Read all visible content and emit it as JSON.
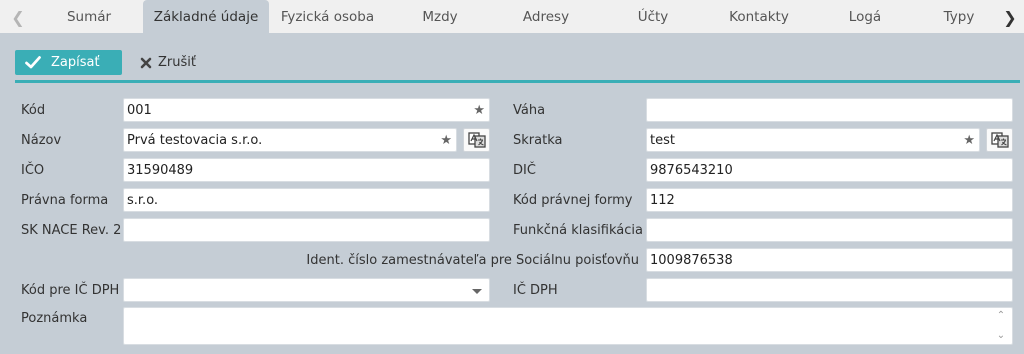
{
  "tabs": [
    {
      "label": "Sumár",
      "active": false
    },
    {
      "label": "Základné údaje",
      "active": true
    },
    {
      "label": "Fyzická osoba",
      "active": false
    },
    {
      "label": "Mzdy",
      "active": false
    },
    {
      "label": "Adresy",
      "active": false
    },
    {
      "label": "Účty",
      "active": false
    },
    {
      "label": "Kontakty",
      "active": false
    },
    {
      "label": "Logá",
      "active": false
    },
    {
      "label": "Typy",
      "active": false
    }
  ],
  "toolbar": {
    "save_label": "Zapísať",
    "cancel_label": "Zrušiť"
  },
  "form": {
    "kod": {
      "label": "Kód",
      "value": "001"
    },
    "vaha": {
      "label": "Váha",
      "value": ""
    },
    "nazov": {
      "label": "Názov",
      "value": "Prvá testovacia s.r.o."
    },
    "skratka": {
      "label": "Skratka",
      "value": "test"
    },
    "ico": {
      "label": "IČO",
      "value": "31590489"
    },
    "dic": {
      "label": "DIČ",
      "value": "9876543210"
    },
    "pravna_forma": {
      "label": "Právna forma",
      "value": "s.r.o."
    },
    "kod_pravnej_formy": {
      "label": "Kód právnej formy",
      "value": "112"
    },
    "sk_nace": {
      "label": "SK NACE Rev. 2",
      "value": ""
    },
    "funkcna_klasifikacia": {
      "label": "Funkčná klasifikácia",
      "value": ""
    },
    "ident_cislo": {
      "label": "Ident. číslo zamestnávateľa pre Sociálnu poisťovňu",
      "value": "1009876538"
    },
    "kod_ic_dph": {
      "label": "Kód pre IČ DPH",
      "value": ""
    },
    "ic_dph": {
      "label": "IČ DPH",
      "value": ""
    },
    "poznamka": {
      "label": "Poznámka",
      "value": ""
    }
  },
  "colors": {
    "accent": "#3aaeb6",
    "panel": "#c5cdd5",
    "tabbar": "#f0f0f0"
  },
  "icons": {
    "tab_prev": "chevron-left-icon",
    "tab_next": "chevron-right-icon",
    "save": "check-icon",
    "cancel": "close-icon",
    "favorite": "star-icon",
    "translate": "translate-icon",
    "dropdown": "caret-down-icon"
  }
}
